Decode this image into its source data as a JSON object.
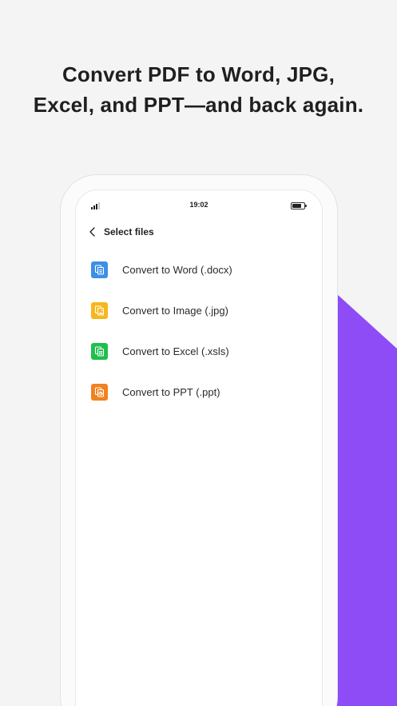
{
  "headline": {
    "line1": "Convert PDF to Word, JPG,",
    "line2": "Excel, and PPT—and back again."
  },
  "status_bar": {
    "time": "19:02",
    "signal_icon": "signal-icon",
    "battery_icon": "battery-icon"
  },
  "nav": {
    "back_icon": "chevron-left-icon",
    "title": "Select files"
  },
  "options": [
    {
      "label": "Convert to Word (.docx)",
      "icon": "word-file-icon",
      "color": "#3d8fe8"
    },
    {
      "label": "Convert to Image (.jpg)",
      "icon": "image-file-icon",
      "color": "#f6b71d"
    },
    {
      "label": "Convert to Excel (.xsls)",
      "icon": "excel-file-icon",
      "color": "#1fbf4d"
    },
    {
      "label": "Convert to PPT (.ppt)",
      "icon": "ppt-file-icon",
      "color": "#f0821f"
    }
  ],
  "colors": {
    "background": "#f4f4f5",
    "accent_purple": "#8d4cf6",
    "text": "#1f1f1f"
  }
}
